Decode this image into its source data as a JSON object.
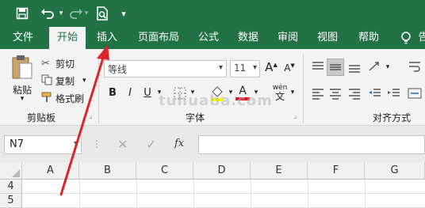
{
  "qat": {
    "save_icon": "save-icon",
    "undo_icon": "undo-icon",
    "redo_icon": "redo-icon",
    "print_preview_icon": "print-preview-icon",
    "customize_icon": "customize-icon"
  },
  "tabs": [
    {
      "label": "文件"
    },
    {
      "label": "开始"
    },
    {
      "label": "插入"
    },
    {
      "label": "页面布局"
    },
    {
      "label": "公式"
    },
    {
      "label": "数据"
    },
    {
      "label": "审阅"
    },
    {
      "label": "视图"
    },
    {
      "label": "帮助"
    },
    {
      "label": "告"
    }
  ],
  "clipboard": {
    "paste": "粘贴",
    "cut": "剪切",
    "copy": "复制",
    "format_painter": "格式刷",
    "group": "剪贴板"
  },
  "font": {
    "name": "等线",
    "size": "11",
    "bold": "B",
    "italic": "I",
    "underline": "U",
    "phonetic_top": "wén",
    "phonetic_bottom": "文",
    "group": "字体",
    "grow": "A",
    "shrink": "A"
  },
  "alignment": {
    "group": "对齐方式"
  },
  "watermark": "tuhuaba.com",
  "namebox": {
    "value": "N7"
  },
  "formula": {
    "fx": "fx"
  },
  "columns": [
    "A",
    "B",
    "C",
    "D",
    "E",
    "F",
    "G"
  ],
  "rows": [
    "4",
    "5"
  ],
  "colors": {
    "brand": "#217346",
    "fill_yellow": "#ffff00",
    "font_red": "#e81123",
    "arrow": "#d9262c"
  }
}
